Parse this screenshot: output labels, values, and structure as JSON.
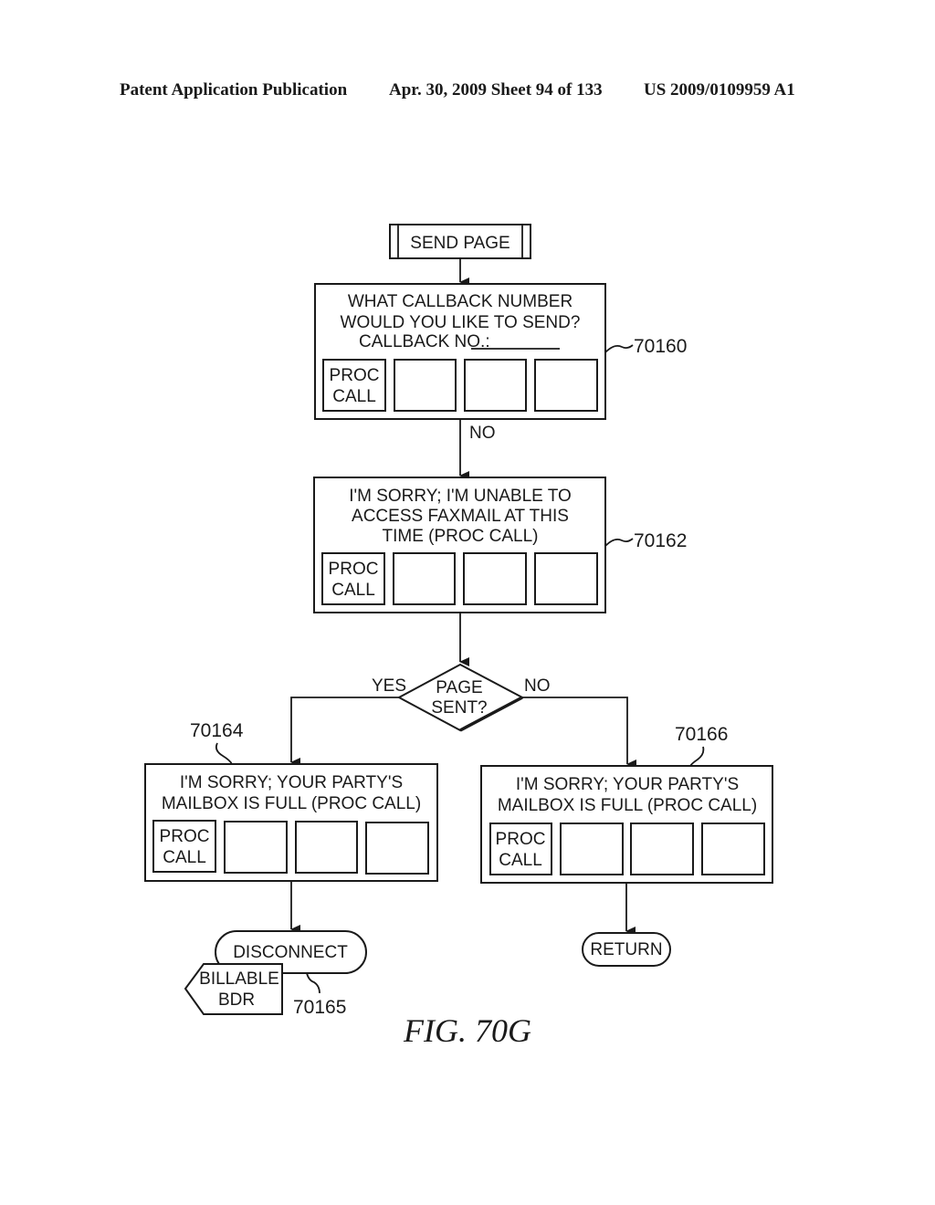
{
  "header": {
    "publication": "Patent Application Publication",
    "date_sheet": "Apr. 30, 2009  Sheet 94 of 133",
    "patent_number": "US 2009/0109959 A1"
  },
  "flowchart": {
    "start": "SEND PAGE",
    "box_70160": {
      "ref": "70160",
      "lines": [
        "WHAT  CALLBACK  NUMBER",
        "WOULD  YOU  LIKE  TO  SEND?",
        "CALLBACK  NO.:"
      ],
      "key1": [
        "PROC",
        "CALL"
      ]
    },
    "edge_no_1": "NO",
    "box_70162": {
      "ref": "70162",
      "lines": [
        "I'M  SORRY;  I'M  UNABLE  TO",
        "ACCESS  FAXMAIL  AT  THIS",
        "TIME  (PROC  CALL)"
      ],
      "key1": [
        "PROC",
        "CALL"
      ]
    },
    "decision": {
      "lines": [
        "PAGE",
        "SENT?"
      ],
      "yes": "YES",
      "no": "NO"
    },
    "box_70164": {
      "ref": "70164",
      "lines": [
        "I'M  SORRY;  YOUR  PARTY'S",
        "MAILBOX  IS  FULL  (PROC  CALL)"
      ],
      "key1": [
        "PROC",
        "CALL"
      ]
    },
    "box_70166": {
      "ref": "70166",
      "lines": [
        "I'M  SORRY;  YOUR  PARTY'S",
        "MAILBOX  IS  FULL  (PROC  CALL)"
      ],
      "key1": [
        "PROC",
        "CALL"
      ]
    },
    "disconnect": {
      "label": "DISCONNECT",
      "ref": "70165"
    },
    "billable": [
      "BILLABLE",
      "BDR"
    ],
    "return": "RETURN"
  },
  "figure_label": "FIG.  70G"
}
